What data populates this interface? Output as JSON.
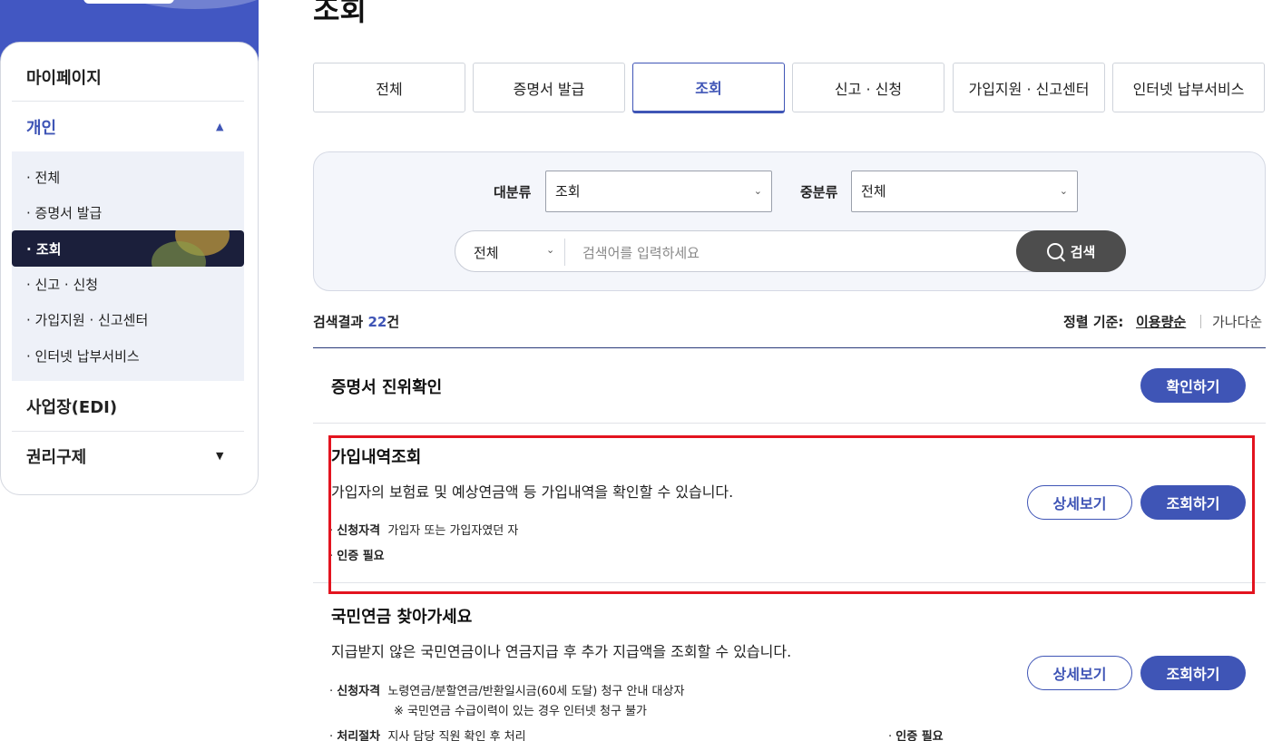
{
  "page_title": "조회",
  "sidebar": {
    "mypage": "마이페이지",
    "personal": "개인",
    "personal_arrow": "▲",
    "sub_items": [
      "· 전체",
      "· 증명서 발급",
      "· 조회",
      "· 신고 · 신청",
      "· 가입지원 · 신고센터",
      "· 인터넷 납부서비스"
    ],
    "business": "사업장(EDI)",
    "rights": "권리구제",
    "rights_arrow": "▼"
  },
  "tabs": [
    "전체",
    "증명서 발급",
    "조회",
    "신고 · 신청",
    "가입지원 · 신고센터",
    "인터넷 납부서비스"
  ],
  "active_tab": "조회",
  "search": {
    "major_label": "대분류",
    "major_value": "조회",
    "minor_label": "중분류",
    "minor_value": "전체",
    "scope_value": "전체",
    "placeholder": "검색어를 입력하세요",
    "button_label": "검색"
  },
  "results": {
    "prefix": "검색결과",
    "count": "22",
    "suffix": "건",
    "sort_label": "정렬 기준:",
    "sort_active": "이용량순",
    "sort_other": "가나다순"
  },
  "items": [
    {
      "title": "증명서 진위확인",
      "primary_button": "확인하기"
    },
    {
      "title": "가입내역조회",
      "desc": "가입자의 보험료 및 예상연금액 등 가입내역을 확인할 수 있습니다.",
      "eligibility_label": "신청자격",
      "eligibility": "가입자 또는 가입자였던 자",
      "auth": "인증 필요",
      "detail_button": "상세보기",
      "primary_button": "조회하기"
    },
    {
      "title": "국민연금 찾아가세요",
      "desc": "지급받지 않은 국민연금이나 연금지급 후 추가 지급액을 조회할 수 있습니다.",
      "eligibility_label": "신청자격",
      "eligibility": "노령연금/분할연금/반환일시금(60세 도달) 청구 안내 대상자",
      "eligibility_note": "※ 국민연금 수급이력이 있는 경우 인터넷 청구 불가",
      "process_label": "처리절차",
      "process": "지사 담당 직원 확인 후 처리",
      "auth": "인증 필요",
      "detail_button": "상세보기",
      "primary_button": "조회하기"
    }
  ],
  "colors": {
    "accent": "#3f55b6",
    "dark_nav": "#1b1f3b",
    "highlight": "#e3141f"
  }
}
